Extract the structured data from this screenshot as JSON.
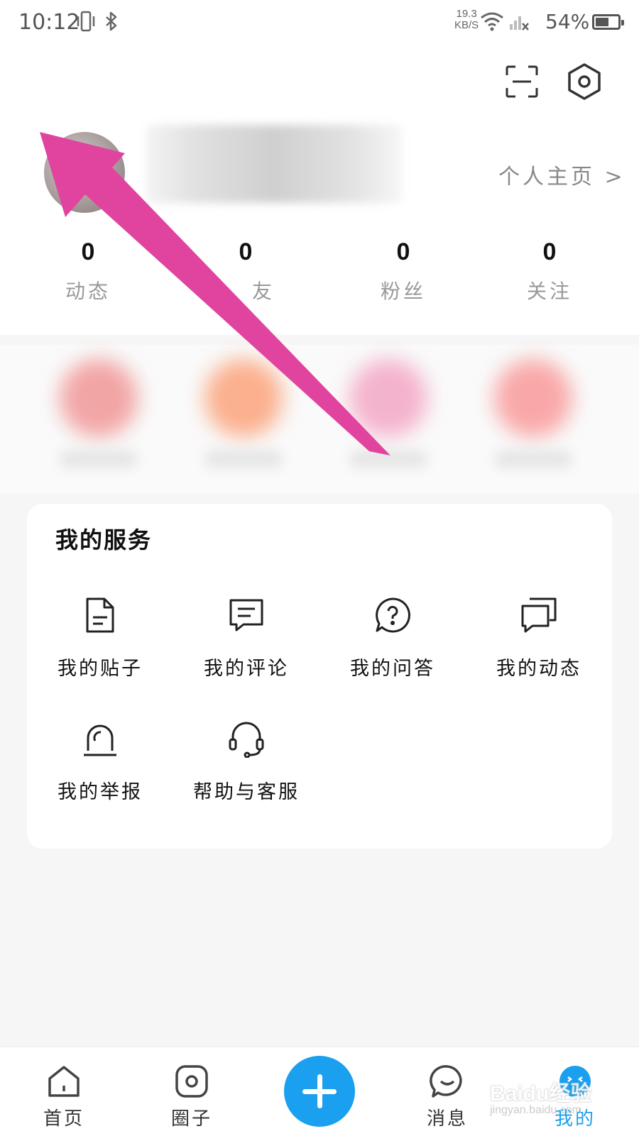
{
  "status_bar": {
    "time": "10:12",
    "net_speed_value": "19.3",
    "net_speed_unit": "KB/S",
    "battery": "54%",
    "battery_level": 0.54
  },
  "header": {
    "homepage_link": "个人主页 >"
  },
  "stats": [
    {
      "value": "0",
      "label": "动态"
    },
    {
      "value": "0",
      "label": "友"
    },
    {
      "value": "0",
      "label": "粉丝"
    },
    {
      "value": "0",
      "label": "关注"
    }
  ],
  "services": {
    "title": "我的服务",
    "items": [
      {
        "label": "我的贴子",
        "icon": "document-icon"
      },
      {
        "label": "我的评论",
        "icon": "comment-icon"
      },
      {
        "label": "我的问答",
        "icon": "question-bubble-icon"
      },
      {
        "label": "我的动态",
        "icon": "chat-bubbles-icon"
      },
      {
        "label": "我的举报",
        "icon": "alarm-siren-icon"
      },
      {
        "label": "帮助与客服",
        "icon": "headset-icon"
      }
    ]
  },
  "bottom_nav": {
    "items": [
      {
        "label": "首页",
        "icon": "home-icon"
      },
      {
        "label": "圈子",
        "icon": "circle-icon"
      },
      {
        "label": "消息",
        "icon": "message-icon"
      },
      {
        "label": "我的",
        "icon": "profile-face-icon",
        "active": true
      }
    ],
    "accent_color": "#1aa0ee"
  },
  "watermark": {
    "brand": "Baidu经验",
    "site": "jingyan.baidu.com"
  },
  "annotation_color": "#e0449e"
}
